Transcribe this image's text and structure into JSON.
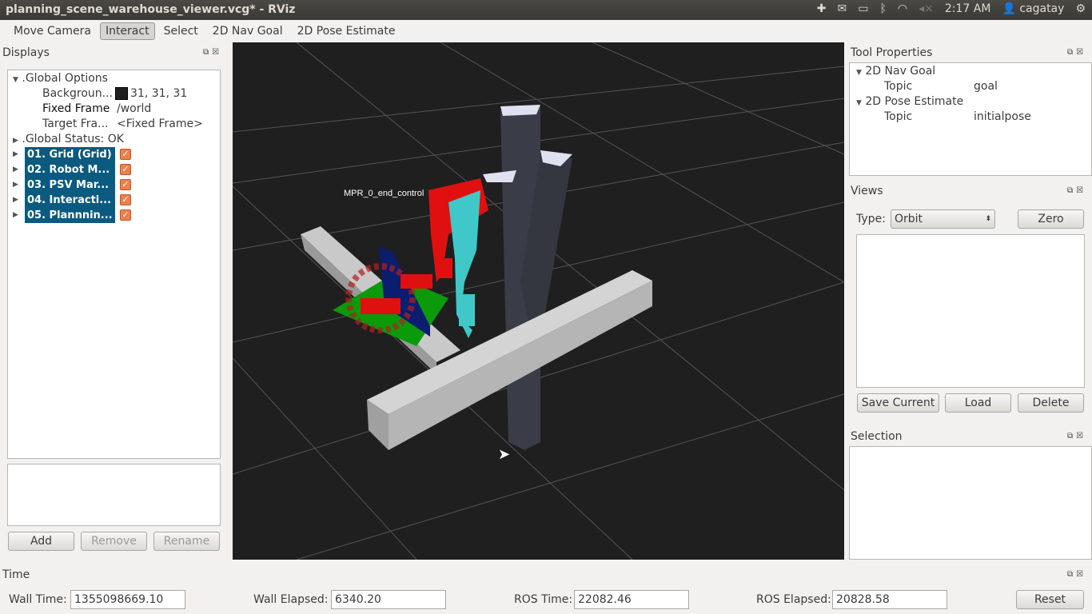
{
  "window": {
    "title": "planning_scene_warehouse_viewer.vcg* - RViz"
  },
  "tray": {
    "icons": [
      "dropbox-icon",
      "mail-icon",
      "battery-icon",
      "bluetooth-icon",
      "wifi-icon",
      "volume-muted-icon",
      "power-gear-icon"
    ],
    "clock": "2:17 AM",
    "user": "cagatay"
  },
  "toolbar": {
    "tools": [
      "Move Camera",
      "Interact",
      "Select",
      "2D Nav Goal",
      "2D Pose Estimate"
    ],
    "active": "Interact"
  },
  "displays": {
    "title": "Displays",
    "global_options": ".Global Options",
    "props": [
      {
        "name": "Backgroun...",
        "value": "31, 31, 31",
        "color": "#1f1f1f"
      },
      {
        "name": "Fixed Frame",
        "value": "/world"
      },
      {
        "name": "Target Fra...",
        "value": "<Fixed Frame>"
      }
    ],
    "global_status": ".Global Status: OK",
    "items": [
      {
        "label": "01. Grid (Grid)",
        "checked": true
      },
      {
        "label": "02. Robot M...",
        "checked": true
      },
      {
        "label": "03. PSV Mar...",
        "checked": true
      },
      {
        "label": "04. Interacti...",
        "checked": true
      },
      {
        "label": "05. Plannnin...",
        "checked": true
      }
    ],
    "buttons": {
      "add": "Add",
      "remove": "Remove",
      "rename": "Rename"
    }
  },
  "viewport": {
    "marker_label": "MPR_0_end_control",
    "background": "#1f1f1f"
  },
  "tool_properties": {
    "title": "Tool Properties",
    "groups": [
      {
        "name": "2D Nav Goal",
        "prop": "Topic",
        "value": "goal"
      },
      {
        "name": "2D Pose Estimate",
        "prop": "Topic",
        "value": "initialpose"
      }
    ]
  },
  "views": {
    "title": "Views",
    "type_label": "Type:",
    "type_value": "Orbit",
    "zero": "Zero",
    "save": "Save Current",
    "load": "Load",
    "delete": "Delete"
  },
  "selection": {
    "title": "Selection"
  },
  "time": {
    "title": "Time",
    "wall_time_label": "Wall Time:",
    "wall_time": "1355098669.10",
    "wall_elapsed_label": "Wall Elapsed:",
    "wall_elapsed": "6340.20",
    "ros_time_label": "ROS Time:",
    "ros_time": "22082.46",
    "ros_elapsed_label": "ROS Elapsed:",
    "ros_elapsed": "20828.58",
    "reset": "Reset"
  }
}
